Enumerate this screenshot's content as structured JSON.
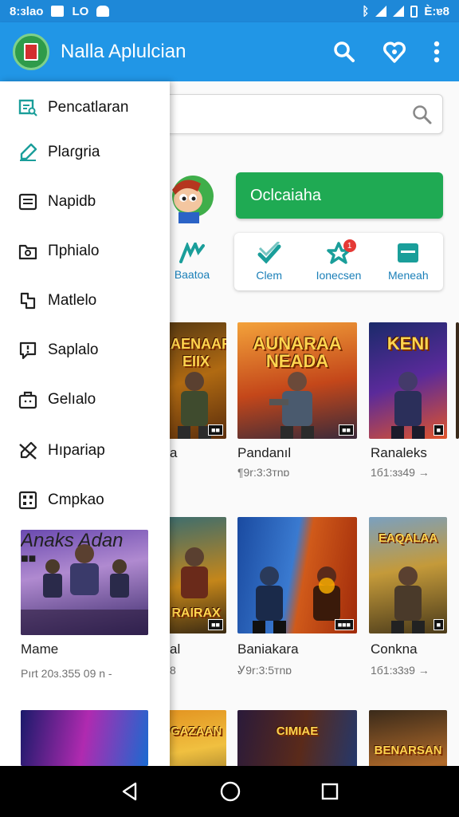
{
  "status_bar": {
    "time_left": "8:ɜlao",
    "badge_text": "LO",
    "time_right": "Ѐ:ɐ8"
  },
  "app_bar": {
    "title": "Nalla Aplulcian",
    "icons": [
      "search-icon",
      "heart-icon",
      "more-vert-icon"
    ]
  },
  "colors": {
    "primary": "#2196e6",
    "status_bar": "#1e88d8",
    "accent_green": "#1faa53",
    "teal_icon": "#1a9e9a"
  },
  "drawer": {
    "items": [
      {
        "label": "Pencatlaran",
        "icon": "search-list-icon"
      },
      {
        "label": "Plaɾgria",
        "icon": "edit-icon"
      },
      {
        "label": "Napidb",
        "icon": "list-icon"
      },
      {
        "label": "Πphialo",
        "icon": "folder-icon"
      },
      {
        "label": "Matlelo",
        "icon": "chat-icon"
      },
      {
        "label": "Saplalo",
        "icon": "alert-message-icon"
      },
      {
        "label": "Gelıalo",
        "icon": "bag-icon"
      },
      {
        "label": "Hıpariap",
        "icon": "no-edit-icon"
      },
      {
        "label": "Cmpkao",
        "icon": "qr-icon"
      }
    ],
    "card": {
      "image_title": "Anaks Adan",
      "name": "Mame",
      "meta": "Pırt 20ɜ.355 09 n -"
    }
  },
  "main": {
    "search_placeholder": "",
    "primary_button": "Oclcaiaha",
    "categories": [
      {
        "label": "Baatoa",
        "icon": "sword-icon"
      },
      {
        "label": "Clem",
        "icon": "check-icon"
      },
      {
        "label": "Ionecsen",
        "icon": "star-icon",
        "badge": "1"
      },
      {
        "label": "Meneah",
        "icon": "box-icon"
      }
    ],
    "row1": [
      {
        "tile_title": "AENAAR EIIX",
        "name": "a",
        "meta": ""
      },
      {
        "tile_title": "AUNARAA NEADA",
        "name": "Pandanıl",
        "meta": "¶9r:3:3ᴛnɒ"
      },
      {
        "tile_title": "KENI",
        "name": "Ranaleks",
        "meta": "1б1:ɜɜ49 →"
      }
    ],
    "row2": [
      {
        "tile_title": "RAIRAX",
        "name": "al",
        "meta": "8"
      },
      {
        "tile_title": "",
        "name": "Baniakara",
        "meta": "Ꮍ9r:3:5ᴛnɒ"
      },
      {
        "tile_title": "EAQALAA",
        "name": "Conkna",
        "meta": "1б1:ɜ3ɜ9 →"
      }
    ],
    "row3": [
      {
        "tile_title": "GAZAAN"
      },
      {
        "tile_title": "CIMIAE"
      },
      {
        "tile_title": "BENARSAN"
      }
    ]
  },
  "nav_bar": {
    "buttons": [
      "back-icon",
      "home-icon",
      "recents-icon"
    ]
  }
}
